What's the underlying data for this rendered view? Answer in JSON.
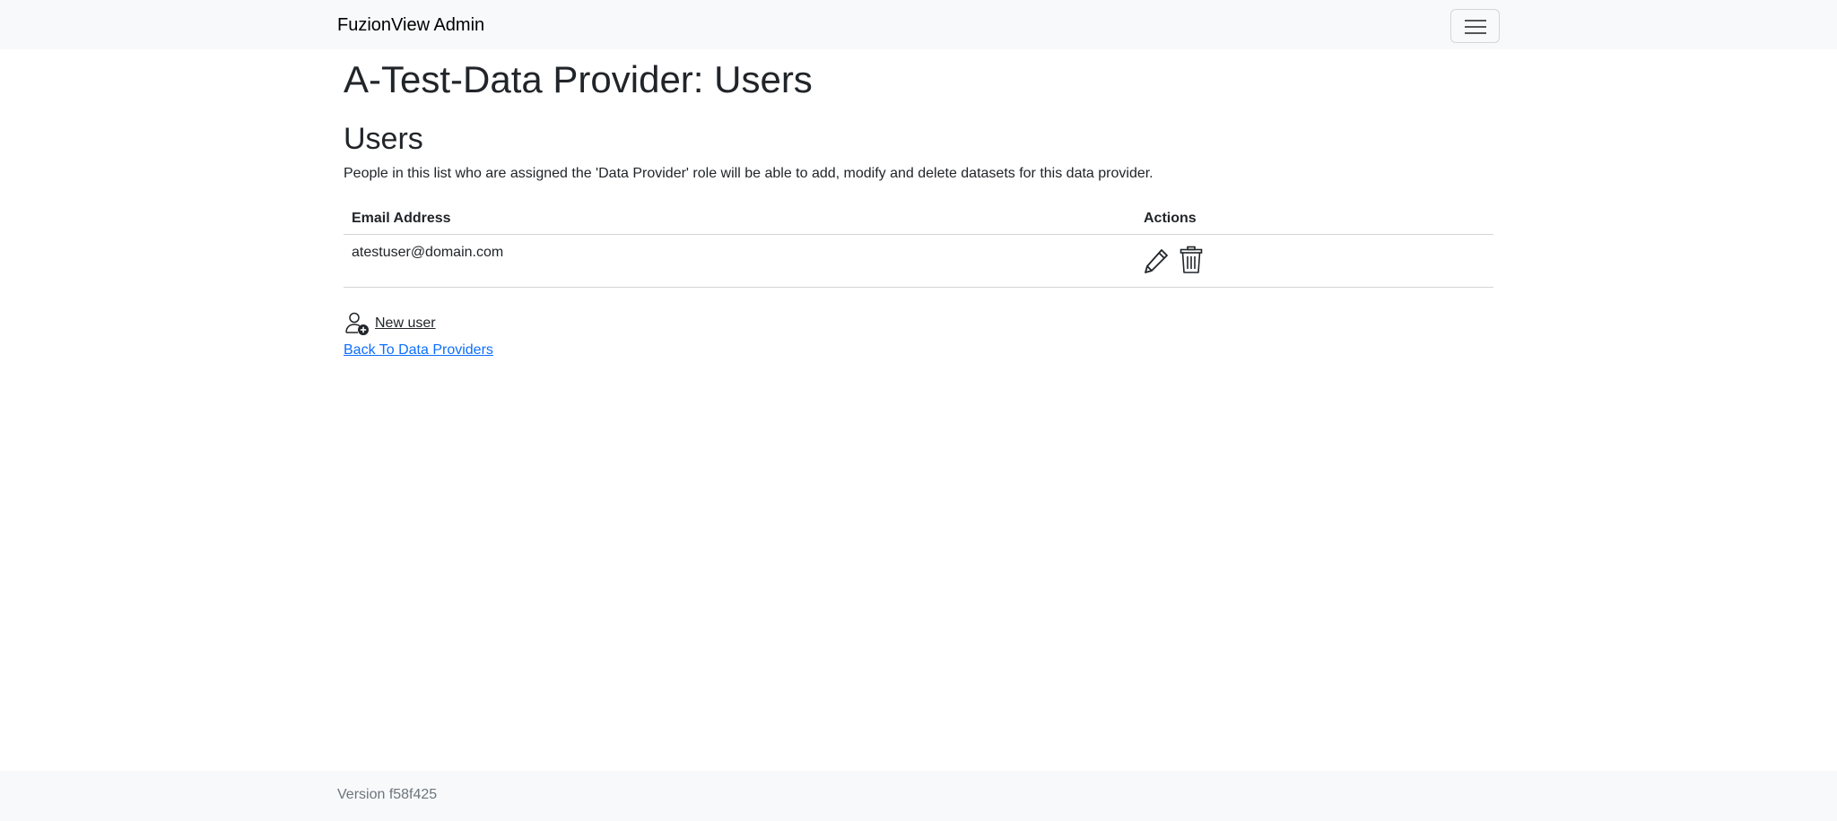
{
  "navbar": {
    "brand": "FuzionView Admin",
    "toggle_icon": "hamburger-menu-icon"
  },
  "page": {
    "title": "A-Test-Data Provider: Users"
  },
  "users_section": {
    "title": "Users",
    "description": "People in this list who are assigned the 'Data Provider' role will be able to add, modify and delete datasets for this data provider.",
    "table": {
      "columns": [
        "Email Address",
        "Actions"
      ],
      "rows": [
        {
          "email": "atestuser@domain.com",
          "actions": [
            "pencil-icon",
            "trash-icon"
          ]
        }
      ]
    },
    "new_user_label": "New user",
    "new_user_icon": "person-add-icon",
    "back_link_label": "Back To Data Providers"
  },
  "footer": {
    "version": "Version f58f425"
  },
  "colors": {
    "navbar_bg": "#f8f9fa",
    "link": "#0d6efd",
    "text": "#212529",
    "muted": "#6c757d"
  }
}
